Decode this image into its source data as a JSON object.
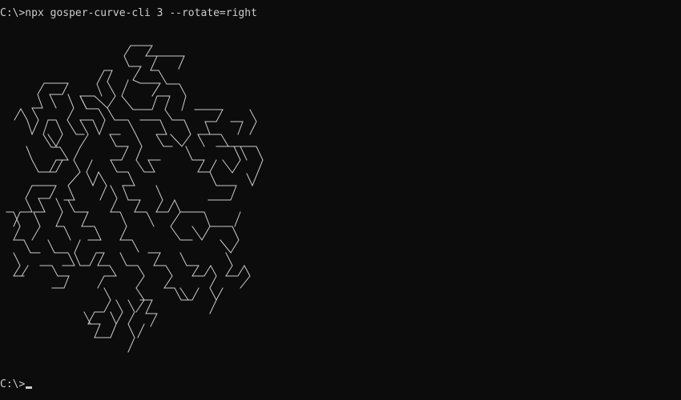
{
  "terminal": {
    "command_line": "C:\\>npx gosper-curve-cli 3 --rotate=right",
    "prompt": "C:\\>"
  },
  "colors": {
    "background": "#0c0c0c",
    "foreground": "#cccccc"
  },
  "curve": {
    "name": "gosper-curve",
    "order": 3,
    "rotate": "right"
  }
}
